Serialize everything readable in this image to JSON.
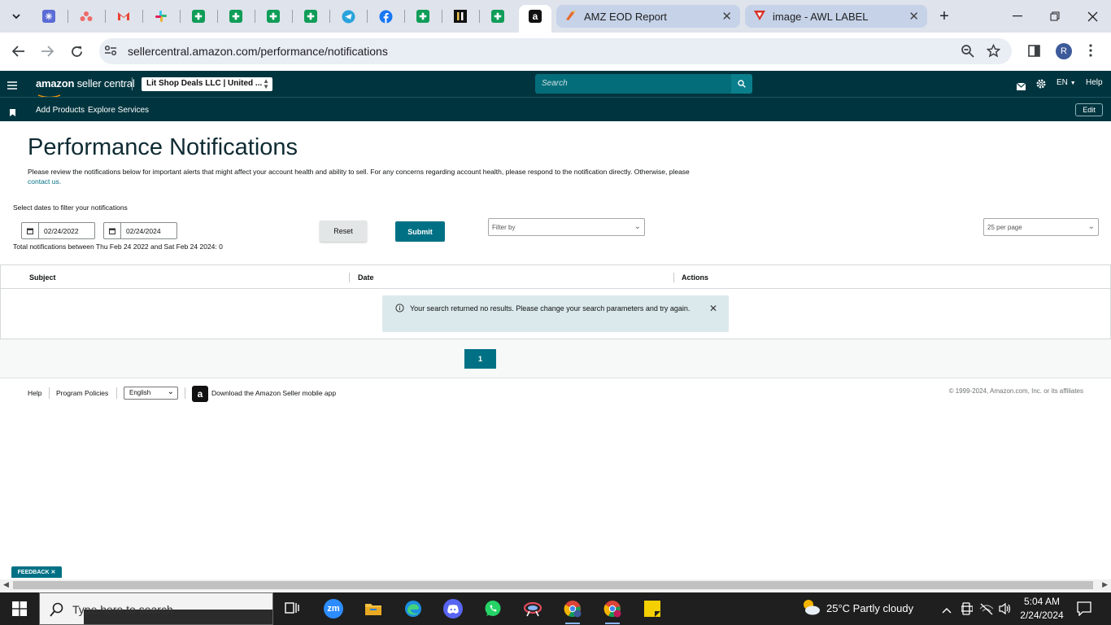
{
  "browser": {
    "pinned_icons": [
      {
        "name": "chevron-down-icon",
        "color": "#dfe3eb"
      },
      {
        "name": "perplexity-icon",
        "color": "#5b6bd6"
      },
      {
        "name": "asana-icon",
        "color": "#f06a6a"
      },
      {
        "name": "gmail-icon",
        "color": "#ea4335"
      },
      {
        "name": "slack-icon",
        "color": "#e01e5a"
      },
      {
        "name": "sheets-icon",
        "color": "#0f9d58"
      },
      {
        "name": "sheets-icon",
        "color": "#0f9d58"
      },
      {
        "name": "sheets-icon",
        "color": "#0f9d58"
      },
      {
        "name": "sheets-icon",
        "color": "#0f9d58"
      },
      {
        "name": "telegram-icon",
        "color": "#2aa3dd"
      },
      {
        "name": "facebook-icon",
        "color": "#1877f2"
      },
      {
        "name": "sheets-icon",
        "color": "#0f9d58"
      },
      {
        "name": "bars-icon",
        "color": "#222222"
      },
      {
        "name": "sheets-icon",
        "color": "#0f9d58"
      },
      {
        "name": "amazon-icon",
        "color": "#111111"
      }
    ],
    "tabs": [
      {
        "title": "AMZ EOD Report",
        "icon": "zoho-icon"
      },
      {
        "title": "image - AWL LABEL",
        "icon": "triangle-logo-icon"
      }
    ],
    "new_tab": "+",
    "url": "sellercentral.amazon.com/performance/notifications",
    "avatar_letter": "R"
  },
  "amazon": {
    "logo_bold": "amazon",
    "logo_rest": " seller central",
    "account": "Lit Shop Deals LLC | United ...",
    "search_placeholder": "Search",
    "lang": "EN",
    "help": "Help",
    "nav": [
      "Add Products",
      "Explore Services"
    ],
    "edit": "Edit"
  },
  "page": {
    "title": "Performance Notifications",
    "description": "Please review the notifications below for important alerts that might affect your account health and ability to sell. For any concerns regarding account health, please respond to the notification directly. Otherwise, please",
    "contact_link": "contact us.",
    "filter_label": "Select dates to filter your notifications",
    "date_from": "02/24/2022",
    "date_to": "02/24/2024",
    "total": "Total notifications between Thu Feb 24 2022 and Sat Feb 24 2024: 0",
    "reset": "Reset",
    "submit": "Submit",
    "filter_by": "Filter by",
    "per_page": "25 per page",
    "columns": [
      "Subject",
      "Date",
      "Actions"
    ],
    "alert": "Your search returned no results. Please change your search parameters and try again.",
    "page_number": "1"
  },
  "footer": {
    "help": "Help",
    "policies": "Program Policies",
    "language": "English",
    "app": "Download the Amazon Seller mobile app",
    "copyright": "© 1999-2024, Amazon.com, Inc. or its affiliates",
    "feedback": "FEEDBACK"
  },
  "taskbar": {
    "search_placeholder": "Type here to search",
    "weather": "25°C  Partly cloudy",
    "time": "5:04 AM",
    "date": "2/24/2024"
  }
}
